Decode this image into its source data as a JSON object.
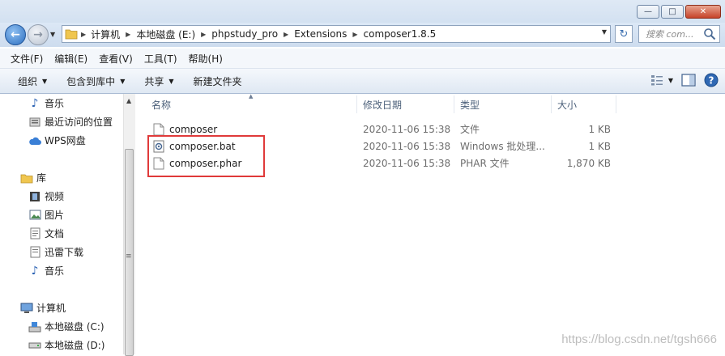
{
  "address": {
    "crumbs": [
      "计算机",
      "本地磁盘 (E:)",
      "phpstudy_pro",
      "Extensions",
      "composer1.8.5"
    ]
  },
  "search": {
    "placeholder": "搜索 com..."
  },
  "menu": [
    "文件(F)",
    "编辑(E)",
    "查看(V)",
    "工具(T)",
    "帮助(H)"
  ],
  "toolbar": {
    "organize": "组织",
    "include_library": "包含到库中",
    "share": "共享",
    "new_folder": "新建文件夹"
  },
  "nav": {
    "music_top": "音乐",
    "recent": "最近访问的位置",
    "wps": "WPS网盘",
    "library": "库",
    "video": "视频",
    "pictures": "图片",
    "documents": "文档",
    "xunlei": "迅雷下载",
    "music": "音乐",
    "computer": "计算机",
    "drive_c": "本地磁盘 (C:)",
    "drive_d": "本地磁盘 (D:)"
  },
  "columns": {
    "name": "名称",
    "date": "修改日期",
    "type": "类型",
    "size": "大小"
  },
  "files": [
    {
      "name": "composer",
      "date": "2020-11-06 15:38",
      "type": "文件",
      "size": "1 KB",
      "icon": "file-icon"
    },
    {
      "name": "composer.bat",
      "date": "2020-11-06 15:38",
      "type": "Windows 批处理...",
      "size": "1 KB",
      "icon": "batch-file-icon"
    },
    {
      "name": "composer.phar",
      "date": "2020-11-06 15:38",
      "type": "PHAR 文件",
      "size": "1,870 KB",
      "icon": "file-icon"
    }
  ],
  "watermark": "https://blog.csdn.net/tgsh666",
  "colors": {
    "highlight": "#e03a3a",
    "header_text": "#4c607a"
  }
}
